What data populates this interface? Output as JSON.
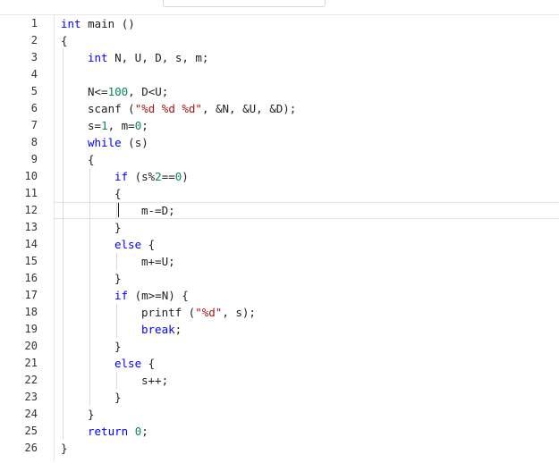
{
  "editor": {
    "colors": {
      "keyword": "#0000ff",
      "string": "#a31515",
      "number": "#098658",
      "text": "#1f1f1f",
      "line_number": "#333333"
    },
    "lines": [
      {
        "n": "1",
        "indent": 0,
        "tokens": [
          {
            "t": "int",
            "c": "kw"
          },
          {
            "t": " main ()",
            "c": ""
          }
        ]
      },
      {
        "n": "2",
        "indent": 0,
        "tokens": [
          {
            "t": "{",
            "c": ""
          }
        ]
      },
      {
        "n": "3",
        "indent": 1,
        "tokens": [
          {
            "t": "int",
            "c": "kw"
          },
          {
            "t": " N, U, D, s, m;",
            "c": ""
          }
        ]
      },
      {
        "n": "4",
        "indent": 1,
        "tokens": []
      },
      {
        "n": "5",
        "indent": 1,
        "tokens": [
          {
            "t": "N<=",
            "c": ""
          },
          {
            "t": "100",
            "c": "num"
          },
          {
            "t": ", D<U;",
            "c": ""
          }
        ]
      },
      {
        "n": "6",
        "indent": 1,
        "tokens": [
          {
            "t": "scanf (",
            "c": ""
          },
          {
            "t": "\"%d %d %d\"",
            "c": "str"
          },
          {
            "t": ", &N, &U, &D);",
            "c": ""
          }
        ]
      },
      {
        "n": "7",
        "indent": 1,
        "tokens": [
          {
            "t": "s=",
            "c": ""
          },
          {
            "t": "1",
            "c": "num"
          },
          {
            "t": ", m=",
            "c": ""
          },
          {
            "t": "0",
            "c": "num"
          },
          {
            "t": ";",
            "c": ""
          }
        ]
      },
      {
        "n": "8",
        "indent": 1,
        "tokens": [
          {
            "t": "while",
            "c": "kw"
          },
          {
            "t": " (s)",
            "c": ""
          }
        ]
      },
      {
        "n": "9",
        "indent": 1,
        "tokens": [
          {
            "t": "{",
            "c": ""
          }
        ]
      },
      {
        "n": "10",
        "indent": 2,
        "tokens": [
          {
            "t": "if",
            "c": "kw"
          },
          {
            "t": " (s%",
            "c": ""
          },
          {
            "t": "2",
            "c": "num"
          },
          {
            "t": "==",
            "c": ""
          },
          {
            "t": "0",
            "c": "num"
          },
          {
            "t": ")",
            "c": ""
          }
        ]
      },
      {
        "n": "11",
        "indent": 2,
        "tokens": [
          {
            "t": "{",
            "c": ""
          }
        ]
      },
      {
        "n": "12",
        "indent": 3,
        "tokens": [
          {
            "t": "m-=D;",
            "c": ""
          }
        ]
      },
      {
        "n": "13",
        "indent": 2,
        "tokens": [
          {
            "t": "}",
            "c": ""
          }
        ]
      },
      {
        "n": "14",
        "indent": 2,
        "tokens": [
          {
            "t": "else",
            "c": "kw"
          },
          {
            "t": " {",
            "c": ""
          }
        ]
      },
      {
        "n": "15",
        "indent": 3,
        "tokens": [
          {
            "t": "m+=U;",
            "c": ""
          }
        ]
      },
      {
        "n": "16",
        "indent": 2,
        "tokens": [
          {
            "t": "}",
            "c": ""
          }
        ]
      },
      {
        "n": "17",
        "indent": 2,
        "tokens": [
          {
            "t": "if",
            "c": "kw"
          },
          {
            "t": " (m>=N) {",
            "c": ""
          }
        ]
      },
      {
        "n": "18",
        "indent": 3,
        "tokens": [
          {
            "t": "printf (",
            "c": ""
          },
          {
            "t": "\"%d\"",
            "c": "str"
          },
          {
            "t": ", s);",
            "c": ""
          }
        ]
      },
      {
        "n": "19",
        "indent": 3,
        "tokens": [
          {
            "t": "break",
            "c": "kw"
          },
          {
            "t": ";",
            "c": ""
          }
        ]
      },
      {
        "n": "20",
        "indent": 2,
        "tokens": [
          {
            "t": "}",
            "c": ""
          }
        ]
      },
      {
        "n": "21",
        "indent": 2,
        "tokens": [
          {
            "t": "else",
            "c": "kw"
          },
          {
            "t": " {",
            "c": ""
          }
        ]
      },
      {
        "n": "22",
        "indent": 3,
        "tokens": [
          {
            "t": "s++;",
            "c": ""
          }
        ]
      },
      {
        "n": "23",
        "indent": 2,
        "tokens": [
          {
            "t": "}",
            "c": ""
          }
        ]
      },
      {
        "n": "24",
        "indent": 1,
        "tokens": [
          {
            "t": "}",
            "c": ""
          }
        ]
      },
      {
        "n": "25",
        "indent": 1,
        "tokens": [
          {
            "t": "return",
            "c": "kw"
          },
          {
            "t": " ",
            "c": ""
          },
          {
            "t": "0",
            "c": "num"
          },
          {
            "t": ";",
            "c": ""
          }
        ]
      },
      {
        "n": "26",
        "indent": 0,
        "tokens": [
          {
            "t": "}",
            "c": ""
          }
        ]
      }
    ]
  }
}
